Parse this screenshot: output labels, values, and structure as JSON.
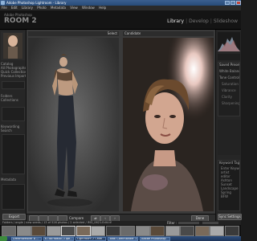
{
  "window": {
    "title": "Adobe Photoshop Lightroom - Library"
  },
  "menu": [
    "File",
    "Edit",
    "Library",
    "Photo",
    "Metadata",
    "View",
    "Window",
    "Help"
  ],
  "identity": {
    "line1": "Adobe Photoshop",
    "line2": "ROOM 2"
  },
  "modules": {
    "active": "Library",
    "items": [
      "Develop",
      "Slideshow"
    ],
    "sep": "|"
  },
  "left_panel": {
    "navigator_label": "",
    "rows": [
      "Catalog",
      "All Photographs",
      "Quick Collection +",
      "Previous Import",
      "",
      "Folders",
      "Collections",
      "Keywording",
      "Search",
      "Metadata"
    ],
    "buttons": {
      "export": "Export"
    }
  },
  "center": {
    "select_label": "Select",
    "candidate_label": "Candidate"
  },
  "toolbar": {
    "compare_label": "Compare",
    "swap_icon": "swap-icon",
    "prev_icon": "chevron-left-icon",
    "next_icon": "chevron-right-icon",
    "done_label": "Done"
  },
  "right_panel": {
    "headers": [
      "Histogram",
      "Saved Preset",
      "White Balance",
      "Tone Control"
    ],
    "rows": [
      "Saturation",
      "Vibrance",
      "Clarity",
      "Sharpening"
    ],
    "keywords": [
      "Keyword Tags",
      "Enter Keywords",
      "artist",
      "editor",
      "Ashton",
      "Sunset",
      "Landscape",
      "Spring",
      "BFW"
    ],
    "sync_label": "Sync Settings",
    "settings_label": "Sync Metadata"
  },
  "filmstrip": {
    "info": "Folders / angle / new seeds / 13 of 526 photos / 2 selected / IMG_0621.Edit.tif",
    "filter_label": "Filter :",
    "thumb_count": 16
  },
  "taskbar": {
    "start_label": "",
    "tasks": [
      "Dreamweaver 8 ...",
      "K Постовой / Пре...",
      "Lightroom 2 Catal...",
      "Total Commander 7...",
      "Adobe Photoshop"
    ]
  },
  "colors": {
    "bg": "#1b1b1b",
    "panel": "#262626",
    "center": "#3a3a3a",
    "accent": "#e6e6e6"
  }
}
